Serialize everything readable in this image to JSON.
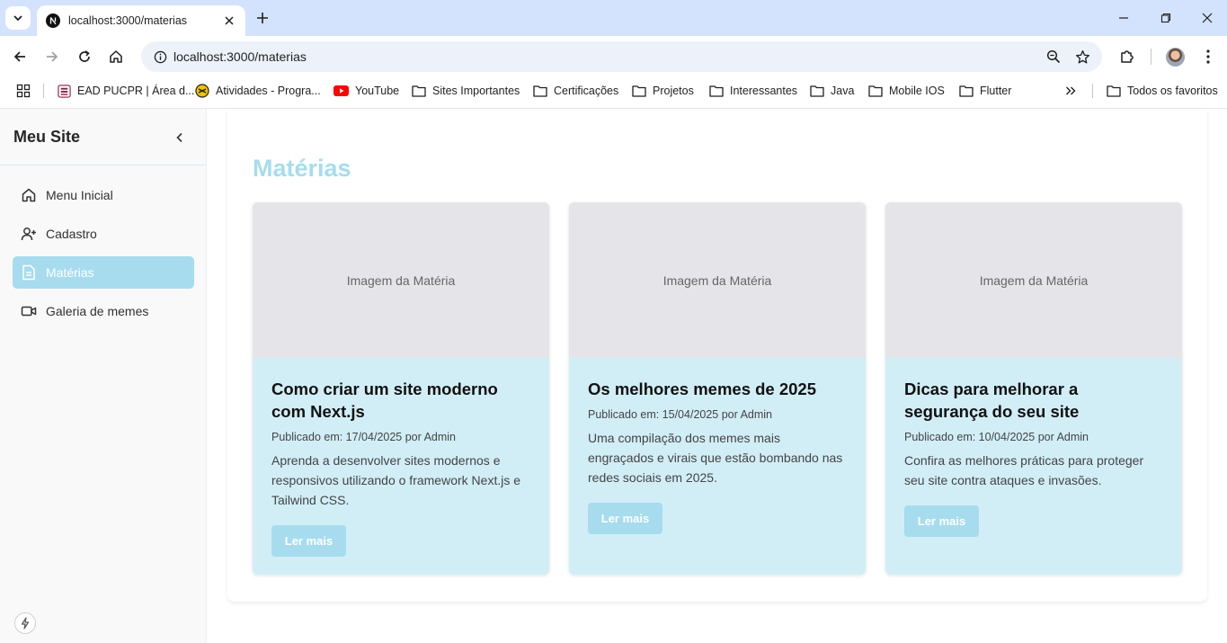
{
  "browser": {
    "tab_title": "localhost:3000/materias",
    "url": "localhost:3000/materias",
    "bookmarks": [
      {
        "label": "EAD PUCPR | Área d...",
        "icon": "pucpr-icon"
      },
      {
        "label": "Atividades - Progra...",
        "icon": "atividades-icon"
      },
      {
        "label": "YouTube",
        "icon": "youtube-icon"
      },
      {
        "label": "Sites Importantes",
        "icon": "folder-icon"
      },
      {
        "label": "Certificações",
        "icon": "folder-icon"
      },
      {
        "label": "Projetos",
        "icon": "folder-icon"
      },
      {
        "label": "Interessantes",
        "icon": "folder-icon"
      },
      {
        "label": "Java",
        "icon": "folder-icon"
      },
      {
        "label": "Mobile IOS",
        "icon": "folder-icon"
      },
      {
        "label": "Flutter",
        "icon": "folder-icon"
      }
    ],
    "all_bookmarks": "Todos os favoritos"
  },
  "sidebar": {
    "brand": "Meu Site",
    "items": [
      {
        "label": "Menu Inicial",
        "icon": "home-icon",
        "active": false
      },
      {
        "label": "Cadastro",
        "icon": "user-plus-icon",
        "active": false
      },
      {
        "label": "Matérias",
        "icon": "document-icon",
        "active": true
      },
      {
        "label": "Galeria de memes",
        "icon": "video-icon",
        "active": false
      }
    ]
  },
  "main": {
    "title": "Matérias",
    "cards": [
      {
        "image_placeholder": "Imagem da Matéria",
        "title": "Como criar um site moderno com Next.js",
        "meta": "Publicado em: 17/04/2025 por Admin",
        "description": "Aprenda a desenvolver sites modernos e responsivos utilizando o framework Next.js e Tailwind CSS.",
        "button": "Ler mais"
      },
      {
        "image_placeholder": "Imagem da Matéria",
        "title": "Os melhores memes de 2025",
        "meta": "Publicado em: 15/04/2025 por Admin",
        "description": "Uma compilação dos memes mais engraçados e virais que estão bombando nas redes sociais em 2025.",
        "button": "Ler mais"
      },
      {
        "image_placeholder": "Imagem da Matéria",
        "title": "Dicas para melhorar a segurança do seu site",
        "meta": "Publicado em: 10/04/2025 por Admin",
        "description": "Confira as melhores práticas para proteger seu site contra ataques e invasões.",
        "button": "Ler mais"
      }
    ]
  },
  "colors": {
    "accent": "#a6dcee",
    "card_bg": "#d1eef7",
    "image_bg": "#e5e5e9",
    "sidebar_bg": "#f9f9fa",
    "chrome_bg": "#d3e3fd"
  }
}
